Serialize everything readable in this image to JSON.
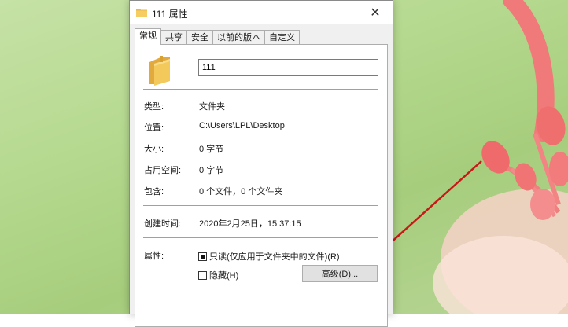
{
  "window": {
    "title": "111 属性",
    "close_symbol": "✕"
  },
  "tabs": [
    {
      "label": "常规",
      "active": true
    },
    {
      "label": "共享",
      "active": false
    },
    {
      "label": "安全",
      "active": false
    },
    {
      "label": "以前的版本",
      "active": false
    },
    {
      "label": "自定义",
      "active": false
    }
  ],
  "general": {
    "icon": "folder-icon",
    "name_value": "111",
    "type_label": "类型:",
    "type_value": "文件夹",
    "location_label": "位置:",
    "location_value": "C:\\Users\\LPL\\Desktop",
    "size_label": "大小:",
    "size_value": "0 字节",
    "size_on_disk_label": "占用空间:",
    "size_on_disk_value": "0 字节",
    "contains_label": "包含:",
    "contains_value": "0 个文件，0 个文件夹",
    "created_label": "创建时间:",
    "created_value": "2020年2月25日，15:37:15",
    "attributes_label": "属性:",
    "readonly_label": "只读(仅应用于文件夹中的文件)(R)",
    "readonly_checked": true,
    "hidden_label": "隐藏(H)",
    "hidden_checked": false,
    "advanced_button": "高级(D)..."
  },
  "colors": {
    "folder_yellow": "#e8b84a",
    "annotation_line": "#c81818"
  }
}
